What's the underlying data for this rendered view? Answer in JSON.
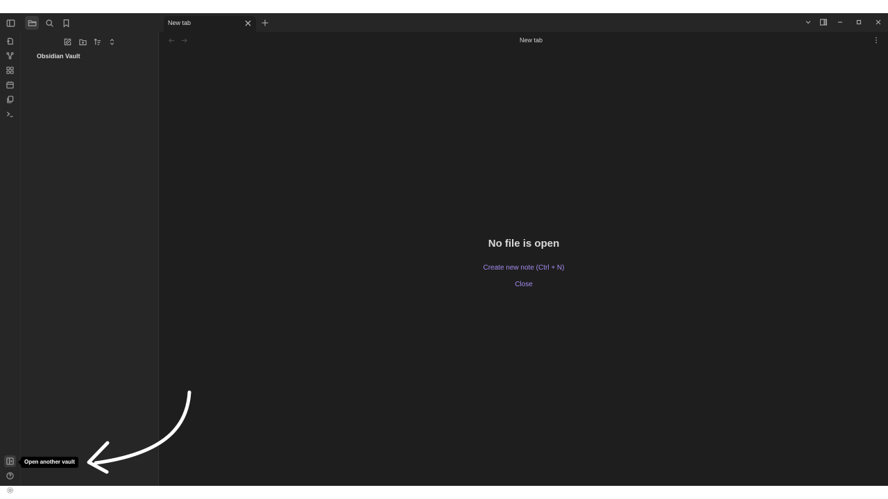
{
  "titlebar": {
    "left_icons": [
      "sidebar-toggle-icon",
      "folder-icon",
      "search-icon",
      "bookmark-icon"
    ],
    "tab": {
      "title": "New tab",
      "close_icon": "close-icon"
    },
    "new_tab_icon": "plus-icon",
    "right_icons": [
      "chevron-down-icon",
      "sidebar-right-icon",
      "minimize-icon",
      "maximize-icon",
      "close-icon"
    ]
  },
  "ribbon": {
    "top_icons": [
      "open-quick-switcher-icon",
      "graph-view-icon",
      "canvas-icon",
      "daily-note-icon",
      "templates-icon",
      "command-palette-icon"
    ],
    "bottom_icons": [
      "open-vault-icon",
      "help-icon",
      "settings-icon"
    ]
  },
  "sidebar": {
    "actions": [
      "new-note-icon",
      "new-folder-icon",
      "sort-icon",
      "collapse-icon"
    ],
    "vault_name": "Obsidian Vault"
  },
  "main": {
    "view_title": "New tab",
    "empty": {
      "title": "No file is open",
      "create_label": "Create new note (Ctrl + N)",
      "close_label": "Close"
    }
  },
  "tooltip": {
    "text": "Open another vault"
  },
  "colors": {
    "accent": "#a58cf0",
    "background": "#1e1e1e",
    "panel": "#262626",
    "annotation": "#ffffff"
  }
}
